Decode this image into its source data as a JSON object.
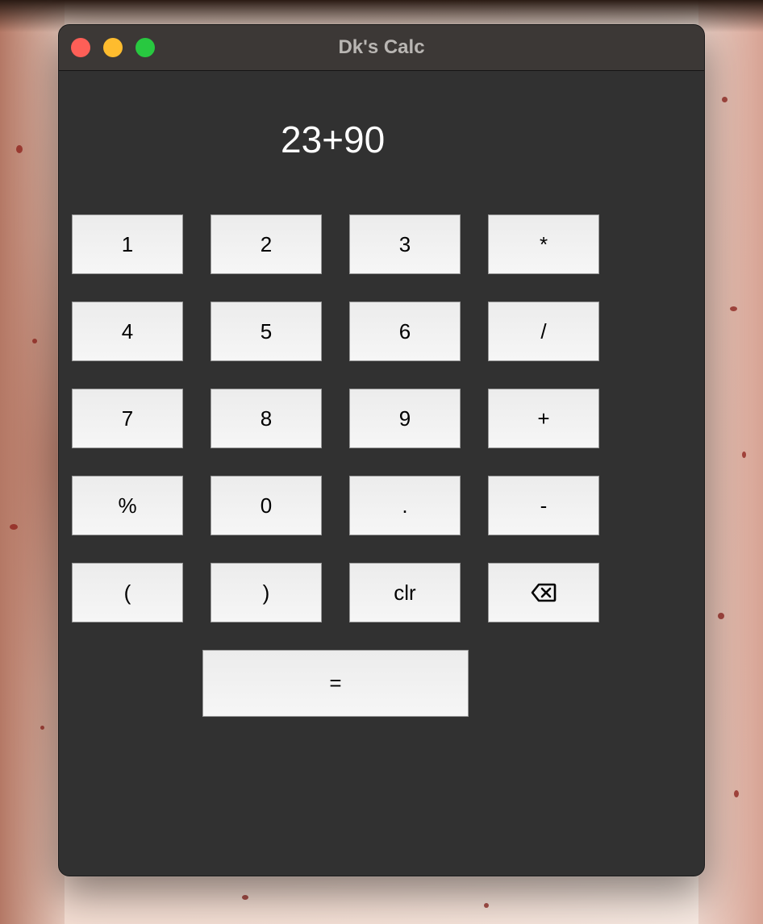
{
  "window": {
    "title": "Dk's Calc"
  },
  "display": {
    "expression": "23+90"
  },
  "keypad": {
    "rows": [
      [
        "1",
        "2",
        "3",
        "*"
      ],
      [
        "4",
        "5",
        "6",
        "/"
      ],
      [
        "7",
        "8",
        "9",
        "+"
      ],
      [
        "%",
        "0",
        ".",
        "-"
      ],
      [
        "(",
        ")",
        "clr",
        "backspace-icon"
      ]
    ],
    "equals": "="
  },
  "colors": {
    "window_bg": "#313131",
    "titlebar_bg": "#3c3836",
    "close": "#fe5f57",
    "minimize": "#febc2e",
    "zoom": "#28c840"
  }
}
